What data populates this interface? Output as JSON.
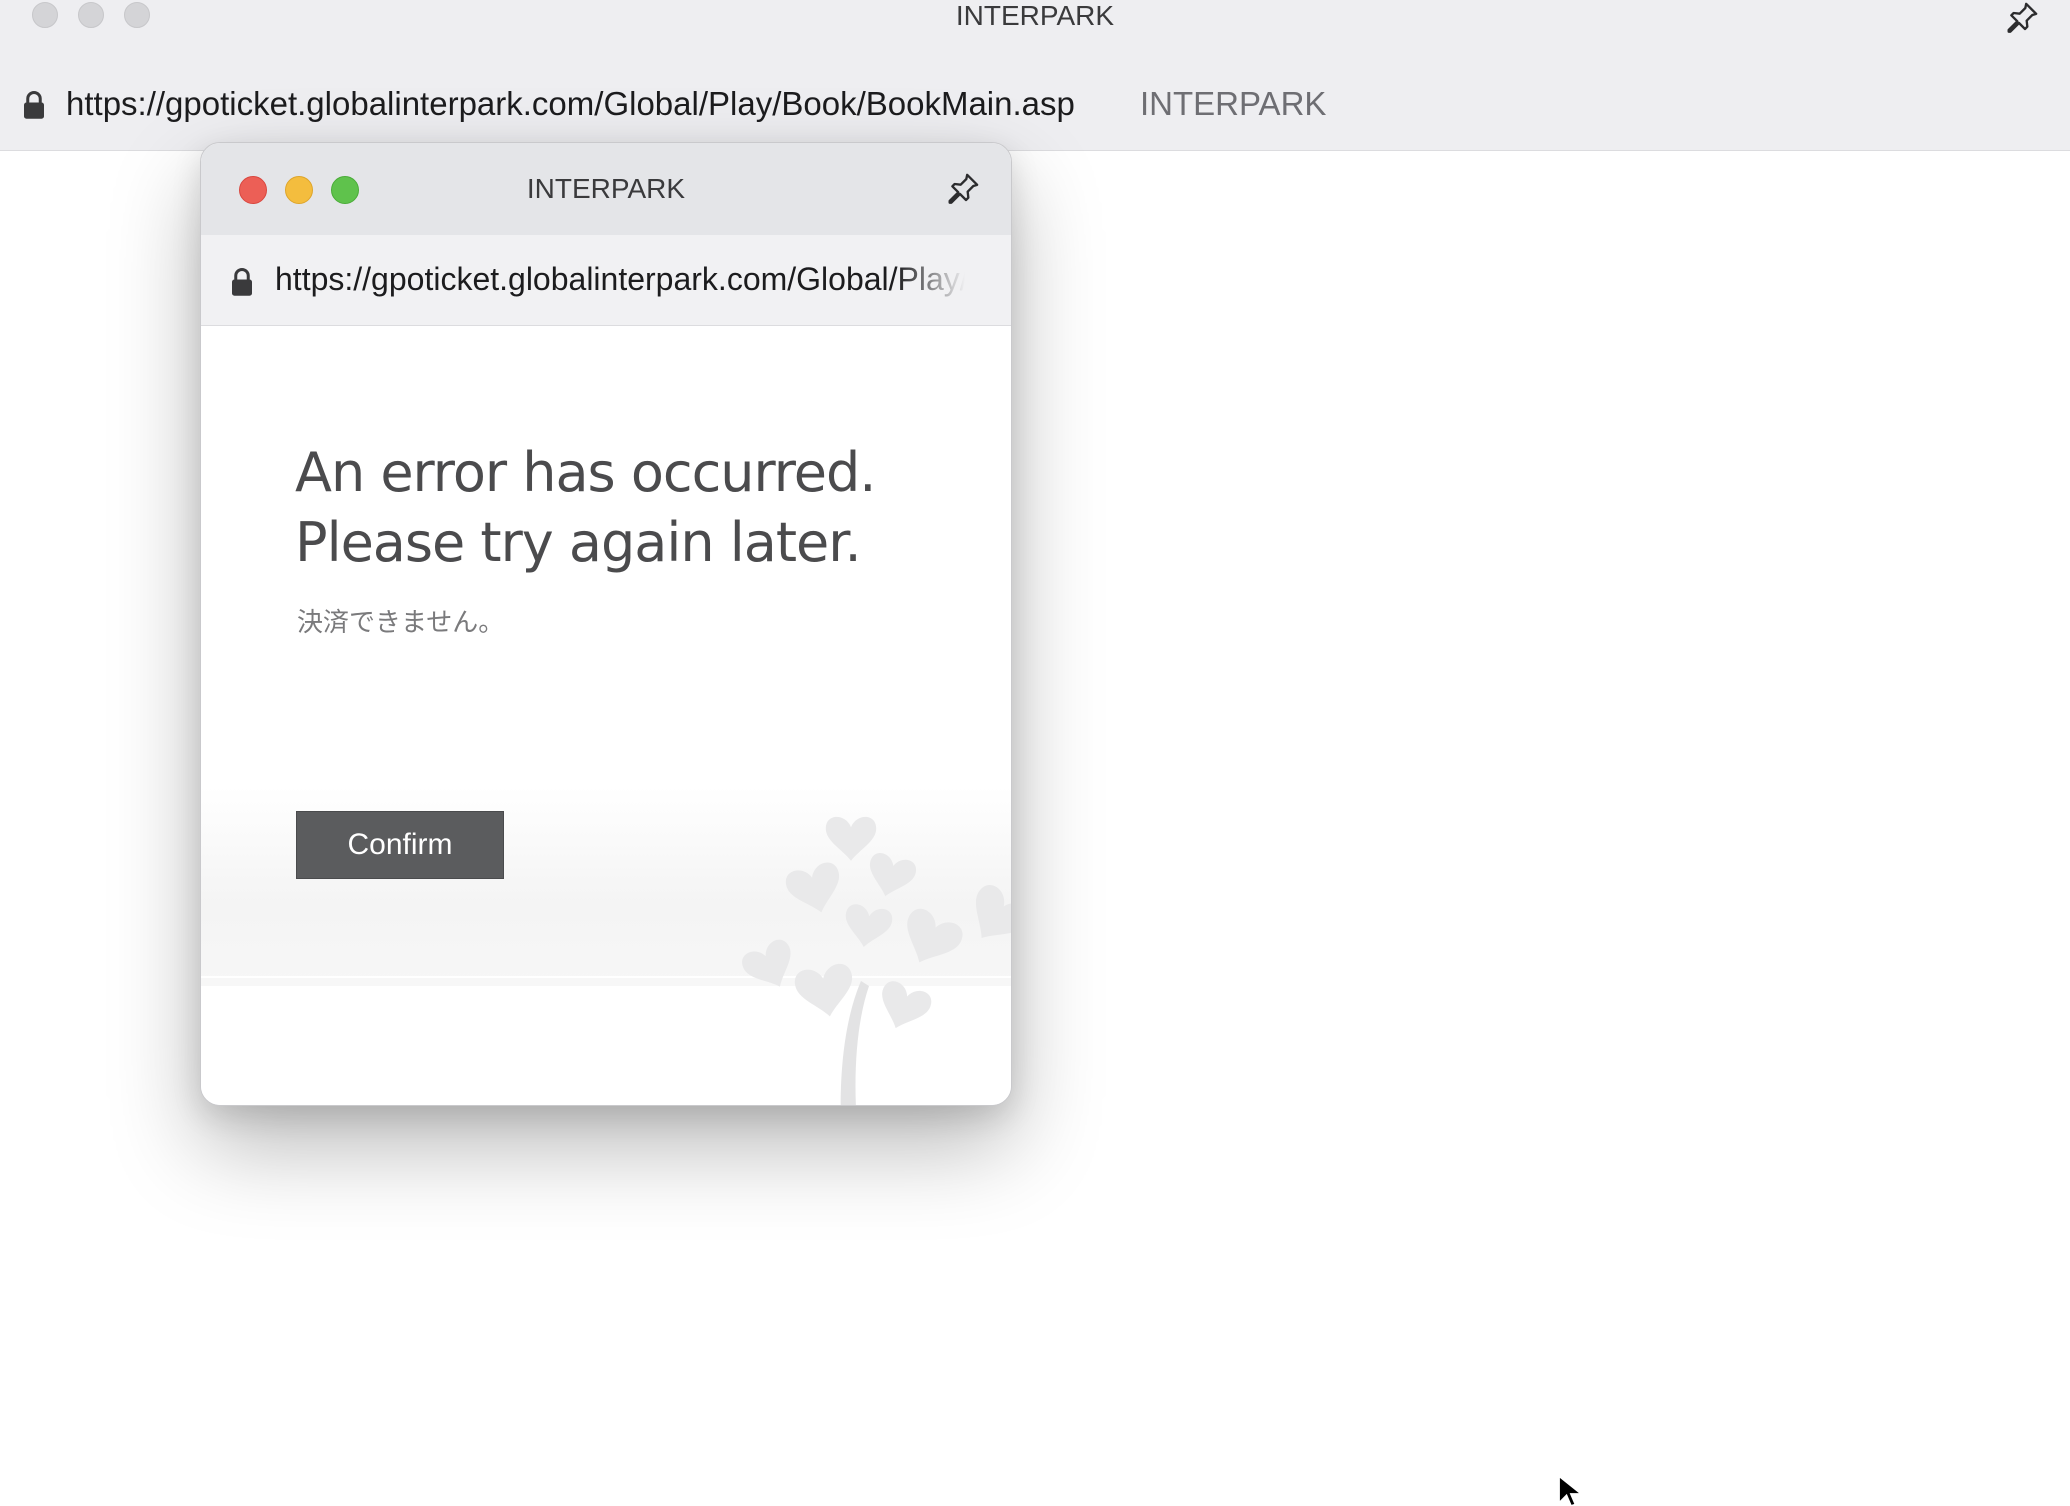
{
  "main_window": {
    "title": "INTERPARK",
    "url": "https://gpoticket.globalinterpark.com/Global/Play/Book/BookMain.asp",
    "site_name": "INTERPARK",
    "icons": [
      "lock-icon",
      "pin-icon"
    ]
  },
  "popup_window": {
    "title": "INTERPARK",
    "url": "https://gpoticket.globalinterpark.com/Global/Play/Book/BookMain.asp",
    "icons": [
      "lock-icon",
      "pin-icon"
    ],
    "traffic_colors": {
      "close": "#ec5f56",
      "minimize": "#f4bd3e",
      "maximize": "#5fc24c"
    }
  },
  "error": {
    "line1": "An error has occurred.",
    "line2": "Please try again later.",
    "detail": "決済できません。",
    "confirm_label": "Confirm",
    "button_color": "#5b5c5e"
  }
}
